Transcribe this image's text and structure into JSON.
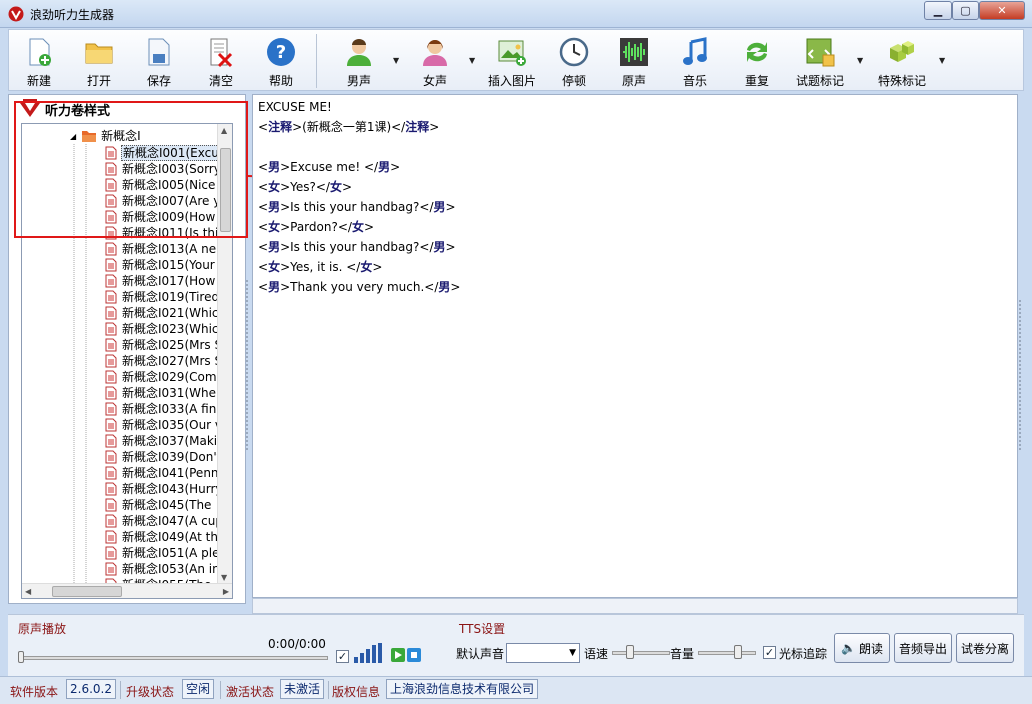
{
  "window": {
    "title": "浪劲听力生成器"
  },
  "toolbar": {
    "new": "新建",
    "open": "打开",
    "save": "保存",
    "clear": "清空",
    "help": "帮助",
    "male": "男声",
    "female": "女声",
    "insert_image": "插入图片",
    "pause": "停顿",
    "original": "原声",
    "music": "音乐",
    "repeat": "重复",
    "question_mark": "试题标记",
    "special_mark": "特殊标记"
  },
  "panel": {
    "title": "听力卷样式"
  },
  "tree": {
    "root": "新概念I",
    "items": [
      "新概念I001(Excu",
      "新概念I003(Sorry",
      "新概念I005(Nice",
      "新概念I007(Are y",
      "新概念I009(How",
      "新概念I011(Is thi",
      "新概念I013(A ne",
      "新概念I015(Your",
      "新概念I017(How",
      "新概念I019(Tired",
      "新概念I021(Whic",
      "新概念I023(Whic",
      "新概念I025(Mrs S",
      "新概念I027(Mrs S",
      "新概念I029(Come",
      "新概念I031(Whe",
      "新概念I033(A fin",
      "新概念I035(Our v",
      "新概念I037(Makin",
      "新概念I039(Don't",
      "新概念I041(Penn",
      "新概念I043(Hurry",
      "新概念I045(The",
      "新概念I047(A cup",
      "新概念I049(At th",
      "新概念I051(A ple",
      "新概念I053(An in",
      "新概念I055(The"
    ]
  },
  "editor": {
    "lines": [
      [
        {
          "t": "text",
          "v": "EXCUSE ME!"
        }
      ],
      [
        {
          "t": "text",
          "v": "<"
        },
        {
          "t": "tag",
          "v": "注释"
        },
        {
          "t": "text",
          "v": ">(新概念一第1课)</"
        },
        {
          "t": "tag",
          "v": "注释"
        },
        {
          "t": "text",
          "v": ">"
        }
      ],
      [],
      [
        {
          "t": "text",
          "v": "<"
        },
        {
          "t": "tag",
          "v": "男"
        },
        {
          "t": "text",
          "v": ">Excuse me! </"
        },
        {
          "t": "tag",
          "v": "男"
        },
        {
          "t": "text",
          "v": ">"
        }
      ],
      [
        {
          "t": "text",
          "v": "<"
        },
        {
          "t": "tag",
          "v": "女"
        },
        {
          "t": "text",
          "v": ">Yes?</"
        },
        {
          "t": "tag",
          "v": "女"
        },
        {
          "t": "text",
          "v": ">"
        }
      ],
      [
        {
          "t": "text",
          "v": "<"
        },
        {
          "t": "tag",
          "v": "男"
        },
        {
          "t": "text",
          "v": ">Is this your handbag?</"
        },
        {
          "t": "tag",
          "v": "男"
        },
        {
          "t": "text",
          "v": ">"
        }
      ],
      [
        {
          "t": "text",
          "v": "<"
        },
        {
          "t": "tag",
          "v": "女"
        },
        {
          "t": "text",
          "v": ">Pardon?</"
        },
        {
          "t": "tag",
          "v": "女"
        },
        {
          "t": "text",
          "v": ">"
        }
      ],
      [
        {
          "t": "text",
          "v": "<"
        },
        {
          "t": "tag",
          "v": "男"
        },
        {
          "t": "text",
          "v": ">Is this your handbag?</"
        },
        {
          "t": "tag",
          "v": "男"
        },
        {
          "t": "text",
          "v": ">"
        }
      ],
      [
        {
          "t": "text",
          "v": "<"
        },
        {
          "t": "tag",
          "v": "女"
        },
        {
          "t": "text",
          "v": ">Yes, it is. </"
        },
        {
          "t": "tag",
          "v": "女"
        },
        {
          "t": "text",
          "v": ">"
        }
      ],
      [
        {
          "t": "text",
          "v": "<"
        },
        {
          "t": "tag",
          "v": "男"
        },
        {
          "t": "text",
          "v": ">Thank you very much.</"
        },
        {
          "t": "tag",
          "v": "男"
        },
        {
          "t": "text",
          "v": ">"
        }
      ]
    ]
  },
  "playback": {
    "label": "原声播放",
    "time": "0:00/0:00"
  },
  "tts": {
    "label": "TTS设置",
    "voice_label": "默认声音",
    "voice_value": "",
    "speed_label": "语速",
    "volume_label": "音量",
    "cursor_follow": "光标追踪",
    "read_btn": "朗读",
    "export_btn": "音频导出",
    "split_btn": "试卷分离"
  },
  "status": {
    "version_label": "软件版本",
    "version": "2.6.0.2",
    "upgrade_label": "升级状态",
    "upgrade": "空闲",
    "activate_label": "激活状态",
    "activate": "未激活",
    "copyright_label": "版权信息",
    "copyright": "上海浪劲信息技术有限公司"
  },
  "colors": {
    "accent_red": "#e01818",
    "tag_color": "#1a1a70",
    "label_red": "#8a1414"
  }
}
